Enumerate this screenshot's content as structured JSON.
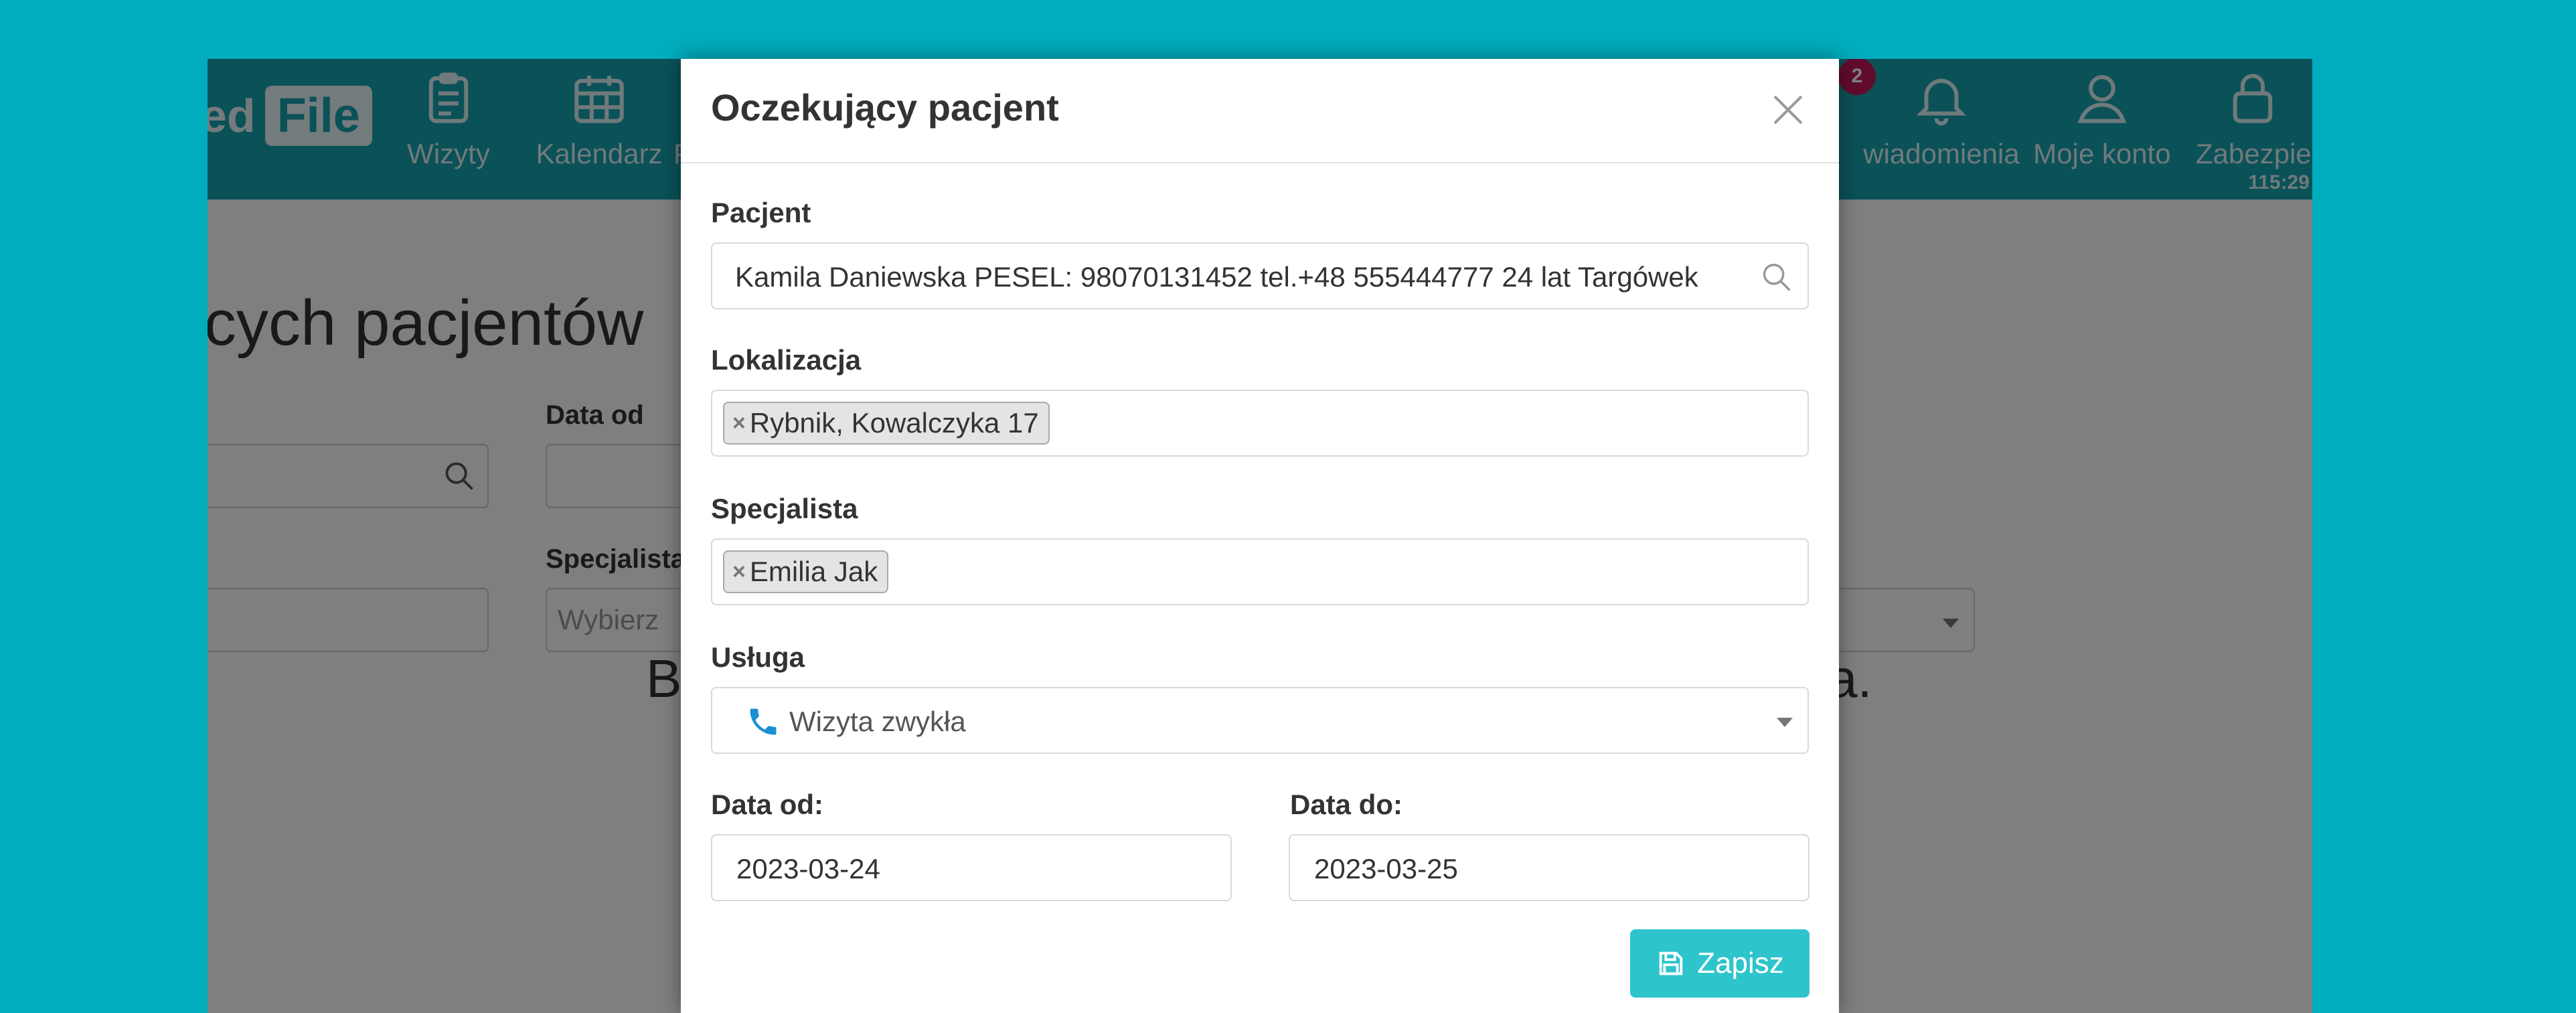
{
  "app": {
    "logo_text": "ed",
    "logo_box_text": "File",
    "nav": [
      {
        "label": "Wizyty",
        "icon": "clipboard-icon"
      },
      {
        "label": "Kalendarz",
        "icon": "calendar-icon"
      },
      {
        "label": "P",
        "icon": ""
      },
      {
        "label": "wiadomienia",
        "icon": "bell-icon"
      },
      {
        "label": "Moje konto",
        "icon": "user-icon"
      },
      {
        "label": "Zabezpie",
        "icon": "lock-icon"
      }
    ],
    "notification_count": "2",
    "session_timer": "115:29"
  },
  "background": {
    "page_title": "cych pacjentów",
    "date_from_label": "Data od",
    "specialist_label": "Specjalista",
    "specialist_placeholder": "Wybierz",
    "message_left": "B",
    "message_right": "a."
  },
  "modal": {
    "title": "Oczekujący pacjent",
    "patient_label": "Pacjent",
    "patient_value": "Kamila Daniewska PESEL: 98070131452 tel.+48 555444777 24 lat Targówek",
    "location_label": "Lokalizacja",
    "location_chip": "Rybnik, Kowalczyka 17",
    "specialist_label": "Specjalista",
    "specialist_chip": "Emilia Jak",
    "service_label": "Usługa",
    "service_value": "Wizyta zwykła",
    "date_from_label": "Data od:",
    "date_from_value": "2023-03-24",
    "date_to_label": "Data do:",
    "date_to_value": "2023-03-25",
    "save_label": "Zapisz",
    "chip_remove": "×"
  },
  "colors": {
    "page_bg": "#00acbd",
    "topbar": "#16a3b1",
    "save_button": "#2ec4cc",
    "phone_icon": "#1a8fd6",
    "badge": "#c2185b"
  }
}
